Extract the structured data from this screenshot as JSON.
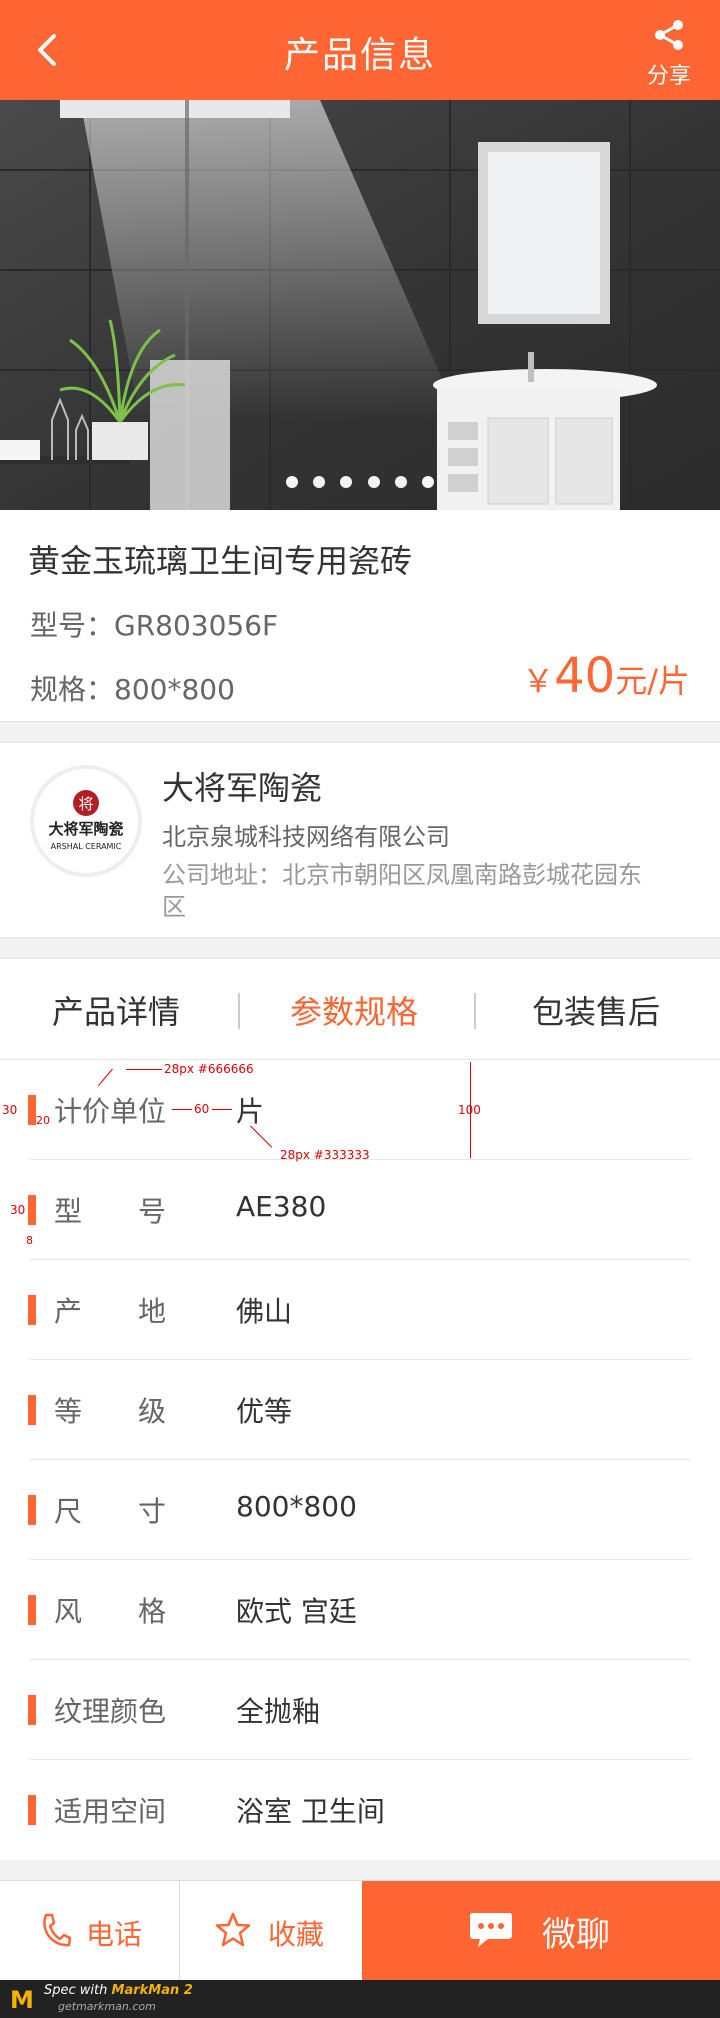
{
  "header": {
    "title": "产品信息",
    "share_label": "分享"
  },
  "carousel": {
    "dot_count": 6,
    "active_index": 0
  },
  "product": {
    "name": "黄金玉琉璃卫生间专用瓷砖",
    "model_label": "型号：",
    "model_value": "GR803056F",
    "spec_label": "规格：",
    "spec_value": "800*800",
    "price_currency": "￥",
    "price_value": "40",
    "price_unit": "元/片"
  },
  "company": {
    "logo_text": "大将军陶瓷",
    "logo_sub": "ARSHAL CERAMIC",
    "logo_seal": "将",
    "name": "大将军陶瓷",
    "org": "北京泉城科技网络有限公司",
    "address": "公司地址：北京市朝阳区凤凰南路彭城花园东区"
  },
  "tabs": [
    {
      "label": "产品详情"
    },
    {
      "label": "参数规格"
    },
    {
      "label": "包装售后"
    }
  ],
  "params": [
    {
      "label": "计价单位",
      "value": "片"
    },
    {
      "label": "型　　号",
      "value": "AE380"
    },
    {
      "label": "产　　地",
      "value": "佛山"
    },
    {
      "label": "等　　级",
      "value": "优等"
    },
    {
      "label": "尺　　寸",
      "value": "800*800"
    },
    {
      "label": "风　　格",
      "value": "欧式 宫廷"
    },
    {
      "label": "纹理颜色",
      "value": "全抛釉"
    },
    {
      "label": "适用空间",
      "value": "浴室 卫生间"
    }
  ],
  "annotations": {
    "label_font": "28px #666666",
    "value_font": "28px  #333333",
    "gap": "60",
    "row_height": "100",
    "bar_height_1": "30",
    "bar_width": "20",
    "bar_height_2": "30",
    "bar_gap": "8"
  },
  "bottom_bar": {
    "phone_label": "电话",
    "favorite_label": "收藏",
    "chat_label": "微聊"
  },
  "footer": {
    "brand_line": "Spec with",
    "brand_name": "MarkMan 2",
    "url": "getmarkman.com"
  },
  "colors": {
    "accent": "#ff6633",
    "text_primary": "#333333",
    "text_secondary": "#666666",
    "text_muted": "#999999",
    "annotation": "#e00000"
  }
}
